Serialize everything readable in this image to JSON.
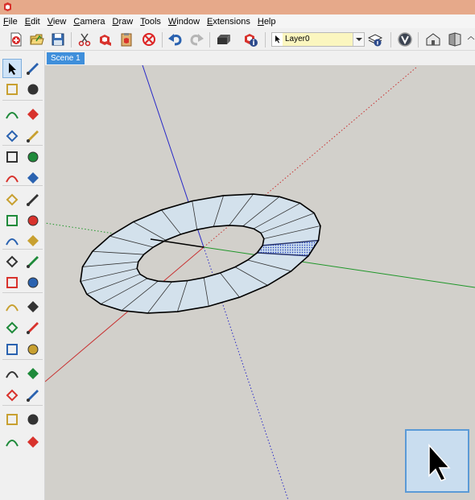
{
  "app": {
    "name": "SketchUp",
    "icon": "sketchup-logo-icon",
    "titlebar_color": "#e6a98a"
  },
  "menu": {
    "items": [
      "File",
      "Edit",
      "View",
      "Camera",
      "Draw",
      "Tools",
      "Window",
      "Extensions",
      "Help"
    ]
  },
  "toolbar": {
    "buttons": [
      "new-icon",
      "open-icon",
      "save-icon",
      "cut-icon",
      "copy-icon",
      "paste-icon",
      "erase-icon",
      "undo-icon",
      "redo-icon",
      "print-icon",
      "model-info-icon",
      "layers-icon",
      "styles-icon",
      "warehouse-icon",
      "extension-warehouse-icon"
    ],
    "layer_selector": {
      "value": "Layer0"
    }
  },
  "scene": {
    "tab_label": "Scene 1"
  },
  "left_toolbar": {
    "tools": [
      "select-tool",
      "make-component-tool",
      "paint-bucket-tool",
      "eraser-tool",
      "line-tool",
      "freehand-tool",
      "rectangle-tool",
      "rotated-rectangle-tool",
      "circle-tool",
      "polygon-tool",
      "arc-tool",
      "two-point-arc-tool",
      "three-point-arc-tool",
      "pie-tool",
      "move-tool",
      "push-pull-tool",
      "rotate-tool",
      "follow-me-tool",
      "scale-tool",
      "offset-tool",
      "tape-measure-tool",
      "dimension-tool",
      "protractor-tool",
      "text-tool",
      "axes-tool",
      "3d-text-tool",
      "orbit-tool",
      "pan-tool",
      "zoom-tool",
      "zoom-window-tool",
      "zoom-extents-tool",
      "previous-view-tool",
      "position-camera-tool",
      "look-around-tool",
      "walk-tool",
      "section-plane-tool"
    ],
    "active_tool": "select-tool"
  },
  "colors": {
    "viewport_background": "#d2d0cb",
    "face_fill": "#d3e1ec",
    "selection_blue": "#1f3cbe",
    "axis_red": "#c83232",
    "axis_green": "#1e9628",
    "axis_blue": "#2828c8",
    "active_tab": "#3f8fdb"
  }
}
